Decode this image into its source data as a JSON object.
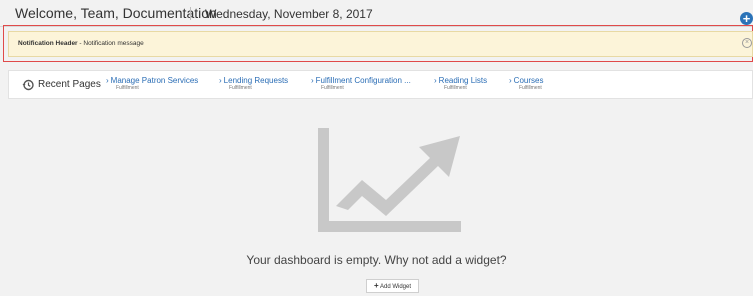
{
  "header": {
    "welcome": "Welcome, Team, Documentation",
    "date": "Wednesday, November 8, 2017"
  },
  "notification": {
    "title": "Notification Header",
    "separator": " - ",
    "message": "Notification message"
  },
  "recent_pages": {
    "label": "Recent Pages",
    "items": [
      {
        "title": "Manage Patron Services",
        "subtitle": "Fulfillment"
      },
      {
        "title": "Lending Requests",
        "subtitle": "Fulfillment"
      },
      {
        "title": "Fulfillment Configuration ...",
        "subtitle": "Fulfillment"
      },
      {
        "title": "Reading Lists",
        "subtitle": "Fulfillment"
      },
      {
        "title": "Courses",
        "subtitle": "Fulfillment"
      }
    ]
  },
  "dashboard": {
    "empty_message": "Your dashboard is empty. Why not add a widget?",
    "add_widget_label": "Add Widget"
  },
  "colors": {
    "accent": "#2b73b8",
    "notification_bg": "#fcf4d9",
    "highlight_outline": "#e04a4a"
  }
}
